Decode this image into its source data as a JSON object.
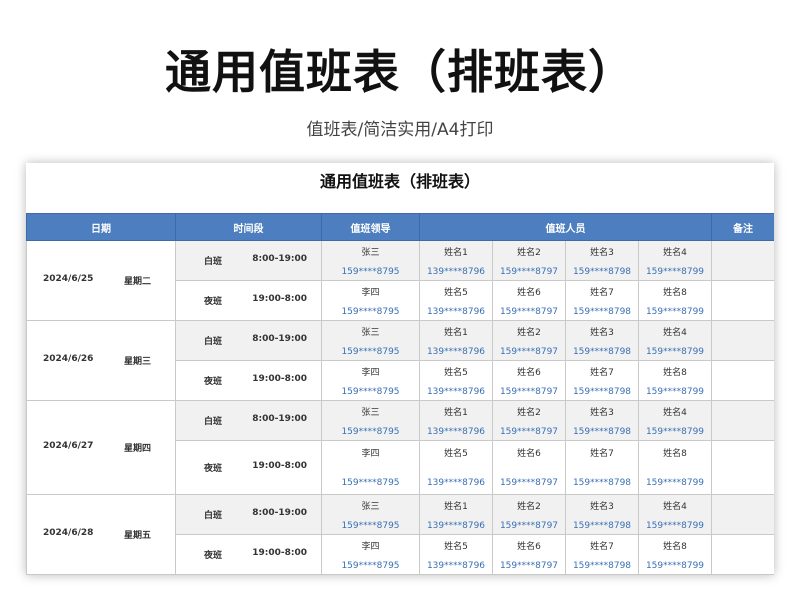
{
  "header": {
    "title": "通用值班表（排班表）",
    "subtitle": "值班表/简洁实用/A4打印"
  },
  "sheet": {
    "title": "通用值班表（排班表）",
    "columns": {
      "date": "日期",
      "time": "时间段",
      "leader": "值班领导",
      "staff": "值班人员",
      "note": "备注"
    },
    "days": [
      {
        "date": "2024/6/25",
        "weekday": "星期二",
        "shifts": [
          {
            "shift": "白班",
            "time": "8:00-19:00",
            "leader": {
              "name": "张三",
              "phone": "159****8795"
            },
            "staff": [
              {
                "name": "姓名1",
                "phone": "139****8796"
              },
              {
                "name": "姓名2",
                "phone": "159****8797"
              },
              {
                "name": "姓名3",
                "phone": "159****8798"
              },
              {
                "name": "姓名4",
                "phone": "159****8799"
              }
            ],
            "note": ""
          },
          {
            "shift": "夜班",
            "time": "19:00-8:00",
            "leader": {
              "name": "李四",
              "phone": "159****8795"
            },
            "staff": [
              {
                "name": "姓名5",
                "phone": "139****8796"
              },
              {
                "name": "姓名6",
                "phone": "159****8797"
              },
              {
                "name": "姓名7",
                "phone": "159****8798"
              },
              {
                "name": "姓名8",
                "phone": "159****8799"
              }
            ],
            "note": ""
          }
        ]
      },
      {
        "date": "2024/6/26",
        "weekday": "星期三",
        "shifts": [
          {
            "shift": "白班",
            "time": "8:00-19:00",
            "leader": {
              "name": "张三",
              "phone": "159****8795"
            },
            "staff": [
              {
                "name": "姓名1",
                "phone": "139****8796"
              },
              {
                "name": "姓名2",
                "phone": "159****8797"
              },
              {
                "name": "姓名3",
                "phone": "159****8798"
              },
              {
                "name": "姓名4",
                "phone": "159****8799"
              }
            ],
            "note": ""
          },
          {
            "shift": "夜班",
            "time": "19:00-8:00",
            "leader": {
              "name": "李四",
              "phone": "159****8795"
            },
            "staff": [
              {
                "name": "姓名5",
                "phone": "139****8796"
              },
              {
                "name": "姓名6",
                "phone": "159****8797"
              },
              {
                "name": "姓名7",
                "phone": "159****8798"
              },
              {
                "name": "姓名8",
                "phone": "159****8799"
              }
            ],
            "note": ""
          }
        ]
      },
      {
        "date": "2024/6/27",
        "weekday": "星期四",
        "shifts": [
          {
            "shift": "白班",
            "time": "8:00-19:00",
            "leader": {
              "name": "张三",
              "phone": "159****8795"
            },
            "staff": [
              {
                "name": "姓名1",
                "phone": "139****8796"
              },
              {
                "name": "姓名2",
                "phone": "159****8797"
              },
              {
                "name": "姓名3",
                "phone": "159****8798"
              },
              {
                "name": "姓名4",
                "phone": "159****8799"
              }
            ],
            "note": ""
          },
          {
            "shift": "夜班",
            "time": "19:00-8:00",
            "leader": {
              "name": "李四",
              "phone": "159****8795"
            },
            "staff": [
              {
                "name": "姓名5",
                "phone": "139****8796"
              },
              {
                "name": "姓名6",
                "phone": "159****8797"
              },
              {
                "name": "姓名7",
                "phone": "159****8798"
              },
              {
                "name": "姓名8",
                "phone": "159****8799"
              }
            ],
            "note": ""
          }
        ]
      },
      {
        "date": "2024/6/28",
        "weekday": "星期五",
        "shifts": [
          {
            "shift": "白班",
            "time": "8:00-19:00",
            "leader": {
              "name": "张三",
              "phone": "159****8795"
            },
            "staff": [
              {
                "name": "姓名1",
                "phone": "139****8796"
              },
              {
                "name": "姓名2",
                "phone": "159****8797"
              },
              {
                "name": "姓名3",
                "phone": "159****8798"
              },
              {
                "name": "姓名4",
                "phone": "159****8799"
              }
            ],
            "note": ""
          },
          {
            "shift": "夜班",
            "time": "19:00-8:00",
            "leader": {
              "name": "李四",
              "phone": "159****8795"
            },
            "staff": [
              {
                "name": "姓名5",
                "phone": "139****8796"
              },
              {
                "name": "姓名6",
                "phone": "159****8797"
              },
              {
                "name": "姓名7",
                "phone": "159****8798"
              },
              {
                "name": "姓名8",
                "phone": "159****8799"
              }
            ],
            "note": ""
          }
        ]
      }
    ]
  },
  "colors": {
    "header_bg": "#4d7ebf",
    "phone_text": "#3a6fb5",
    "day_shift_bg": "#f1f1f1"
  }
}
